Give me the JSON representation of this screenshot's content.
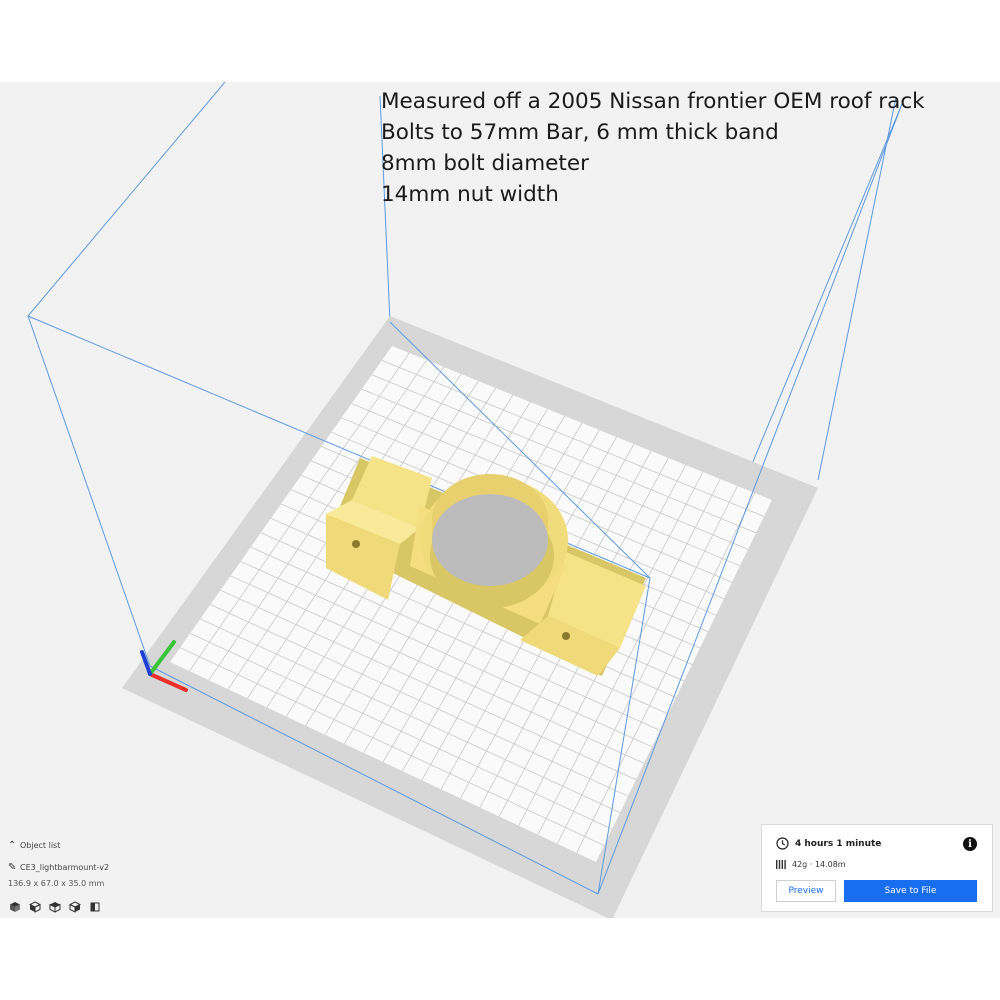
{
  "annotation": {
    "lines": [
      "Measured off a 2005 Nissan frontier OEM roof rack",
      "Bolts to 57mm Bar, 6 mm thick band",
      "8mm bolt diameter",
      "14mm nut width"
    ]
  },
  "object_list": {
    "header": "Object list",
    "object_name": "CE3_lightbarmount-v2",
    "dimensions": "136.9 x 67.0 x 35.0 mm",
    "view_buttons": [
      "3d-view-icon",
      "front-view-icon",
      "top-view-icon",
      "left-view-icon",
      "right-view-icon"
    ]
  },
  "print_panel": {
    "time": "4 hours 1 minute",
    "material": "42g · 14.08m",
    "preview_label": "Preview",
    "save_label": "Save to File",
    "accent_color": "#196ef0"
  },
  "colors": {
    "model": "#f6e388",
    "model_shadow": "#d9c664",
    "bed": "#f7f7f7",
    "frame": "#4a90d9",
    "axis_x": "#e8302a",
    "axis_y": "#3ac43a",
    "axis_z": "#1f3fd6"
  }
}
